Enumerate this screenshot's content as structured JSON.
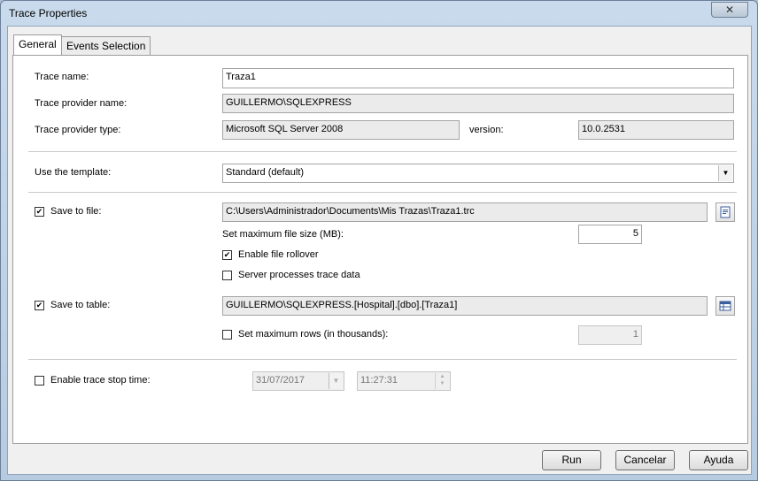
{
  "window": {
    "title": "Trace Properties",
    "close_glyph": "✕"
  },
  "tabs": [
    {
      "label": "General"
    },
    {
      "label": "Events Selection"
    }
  ],
  "general": {
    "trace_name_label": "Trace name:",
    "trace_name_value": "Traza1",
    "provider_name_label": "Trace provider name:",
    "provider_name_value": "GUILLERMO\\SQLEXPRESS",
    "provider_type_label": "Trace provider type:",
    "provider_type_value": "Microsoft SQL Server 2008",
    "version_label": "version:",
    "version_value": "10.0.2531",
    "template_label": "Use the template:",
    "template_value": "Standard (default)",
    "save_to_file_label": "Save to file:",
    "save_to_file_checked": true,
    "save_to_file_path": "C:\\Users\\Administrador\\Documents\\Mis Trazas\\Traza1.trc",
    "max_file_size_label": "Set maximum file size (MB):",
    "max_file_size_value": "5",
    "enable_rollover_label": "Enable file rollover",
    "enable_rollover_checked": true,
    "server_processes_label": "Server processes trace data",
    "server_processes_checked": false,
    "save_to_table_label": "Save to table:",
    "save_to_table_checked": true,
    "save_to_table_value": "GUILLERMO\\SQLEXPRESS.[Hospital].[dbo].[Traza1]",
    "max_rows_label": "Set maximum rows (in thousands):",
    "max_rows_checked": false,
    "max_rows_value": "1",
    "stop_time_label": "Enable trace stop time:",
    "stop_time_checked": false,
    "stop_date_value": "31/07/2017",
    "stop_time_value": "11:27:31"
  },
  "buttons": {
    "run": "Run",
    "cancel": "Cancelar",
    "help": "Ayuda"
  }
}
